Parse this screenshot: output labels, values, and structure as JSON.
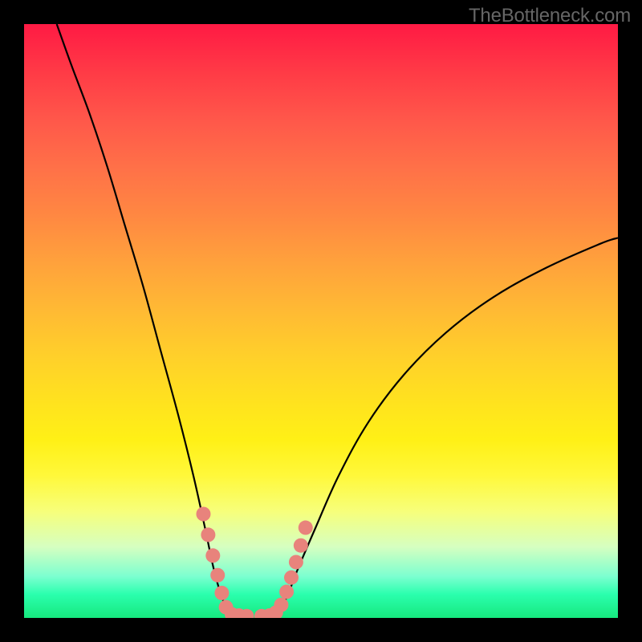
{
  "watermark_text": "TheBottleneck.com",
  "chart_data": {
    "type": "line",
    "title": "",
    "xlabel": "",
    "ylabel": "",
    "x_range": [
      0,
      100
    ],
    "y_range": [
      0,
      100
    ],
    "left_curve": {
      "description": "steep descending curve from top-left falling to bottom near x≈34",
      "points": [
        {
          "x": 5.5,
          "y": 100
        },
        {
          "x": 8,
          "y": 93
        },
        {
          "x": 11,
          "y": 85
        },
        {
          "x": 14,
          "y": 76
        },
        {
          "x": 17,
          "y": 66
        },
        {
          "x": 20,
          "y": 56
        },
        {
          "x": 23,
          "y": 45
        },
        {
          "x": 26,
          "y": 34
        },
        {
          "x": 28.5,
          "y": 24
        },
        {
          "x": 30.5,
          "y": 15
        },
        {
          "x": 32,
          "y": 8
        },
        {
          "x": 33.5,
          "y": 3
        },
        {
          "x": 35,
          "y": 0.5
        }
      ]
    },
    "right_curve": {
      "description": "rising curve from bottom near x≈42 up toward right edge",
      "points": [
        {
          "x": 42,
          "y": 0.5
        },
        {
          "x": 44,
          "y": 3
        },
        {
          "x": 46,
          "y": 8
        },
        {
          "x": 49,
          "y": 15
        },
        {
          "x": 53,
          "y": 24
        },
        {
          "x": 58,
          "y": 33
        },
        {
          "x": 64,
          "y": 41
        },
        {
          "x": 71,
          "y": 48
        },
        {
          "x": 79,
          "y": 54
        },
        {
          "x": 88,
          "y": 59
        },
        {
          "x": 97,
          "y": 63
        },
        {
          "x": 100,
          "y": 64
        }
      ]
    },
    "markers": {
      "description": "pink/salmon rounded dots clustered near valley bottom on both curve legs",
      "left_cluster": [
        {
          "x": 30.2,
          "y": 17.5
        },
        {
          "x": 31.0,
          "y": 14.0
        },
        {
          "x": 31.8,
          "y": 10.5
        },
        {
          "x": 32.6,
          "y": 7.2
        },
        {
          "x": 33.3,
          "y": 4.2
        },
        {
          "x": 34.0,
          "y": 1.8
        },
        {
          "x": 35.0,
          "y": 0.6
        },
        {
          "x": 36.2,
          "y": 0.4
        },
        {
          "x": 37.5,
          "y": 0.3
        }
      ],
      "right_cluster": [
        {
          "x": 40.0,
          "y": 0.3
        },
        {
          "x": 41.3,
          "y": 0.4
        },
        {
          "x": 42.4,
          "y": 0.9
        },
        {
          "x": 43.3,
          "y": 2.2
        },
        {
          "x": 44.2,
          "y": 4.4
        },
        {
          "x": 45.0,
          "y": 6.8
        },
        {
          "x": 45.8,
          "y": 9.4
        },
        {
          "x": 46.6,
          "y": 12.2
        },
        {
          "x": 47.4,
          "y": 15.2
        }
      ]
    },
    "colors": {
      "gradient_top": "#ff1a44",
      "gradient_mid": "#ffe31e",
      "gradient_bottom": "#16e87e",
      "curve": "#000000",
      "marker": "#e8837c",
      "frame": "#000000"
    }
  }
}
